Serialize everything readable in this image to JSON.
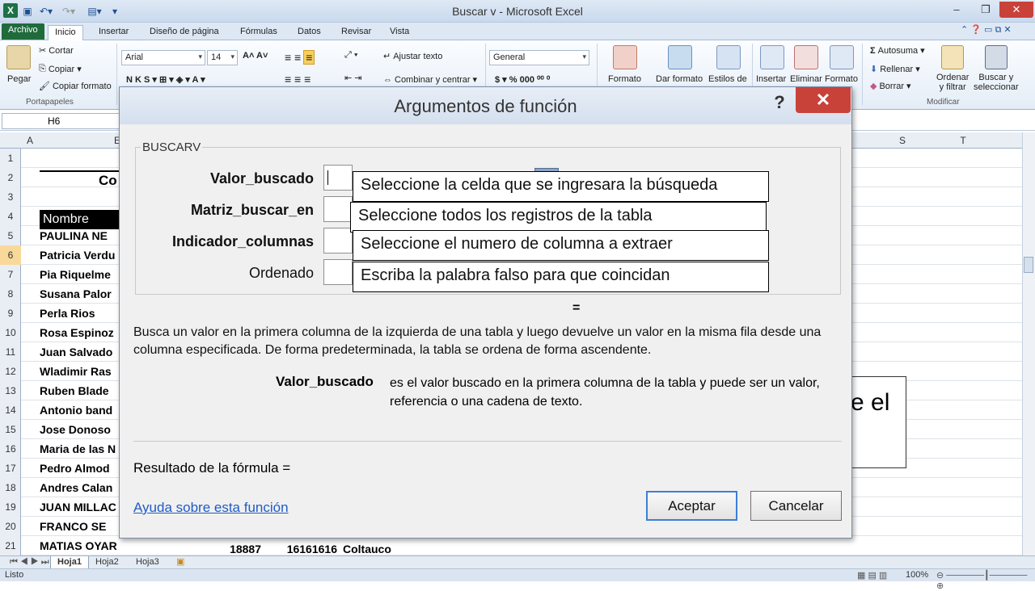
{
  "window": {
    "title": "Buscar v  -  Microsoft Excel"
  },
  "ribbon_tabs": [
    "Archivo",
    "Inicio",
    "Insertar",
    "Diseño de página",
    "Fórmulas",
    "Datos",
    "Revisar",
    "Vista"
  ],
  "ribbon": {
    "paste": "Pegar",
    "cut": "Cortar",
    "copy": "Copiar",
    "copy_format": "Copiar formato",
    "clipboard_group": "Portapapeles",
    "font_name": "Arial",
    "font_size": "14",
    "wrap_text": "Ajustar texto",
    "merge_center": "Combinar y centrar",
    "number_format": "General",
    "format_btn": "Formato",
    "give_format": "Dar formato",
    "styles": "Estilos de",
    "insert": "Insertar",
    "delete": "Eliminar",
    "format2": "Formato",
    "autosum": "Autosuma",
    "fill": "Rellenar",
    "clear": "Borrar",
    "sort_filter_1": "Ordenar",
    "sort_filter_2": "y filtrar",
    "find_select_1": "Buscar y",
    "find_select_2": "seleccionar",
    "modify_group": "Modificar"
  },
  "namebox": "H6",
  "columns": {
    "a": "A",
    "b": "E",
    "s": "S",
    "t": "T"
  },
  "sheet": {
    "title_fragment": "Co",
    "header": "Nombre",
    "rows": [
      {
        "n": "1",
        "name": ""
      },
      {
        "n": "2",
        "name": ""
      },
      {
        "n": "3",
        "name": ""
      },
      {
        "n": "4",
        "name": ""
      },
      {
        "n": "5",
        "name": "PAULINA  NE"
      },
      {
        "n": "6",
        "name": "Patricia Verdu"
      },
      {
        "n": "7",
        "name": "Pia Riquelme"
      },
      {
        "n": "8",
        "name": "Susana Palor"
      },
      {
        "n": "9",
        "name": "Perla Rios"
      },
      {
        "n": "10",
        "name": "Rosa Espinoz"
      },
      {
        "n": "11",
        "name": "Juan Salvado"
      },
      {
        "n": "12",
        "name": "Wladimir Ras"
      },
      {
        "n": "13",
        "name": "Ruben Blade"
      },
      {
        "n": "14",
        "name": "Antonio band"
      },
      {
        "n": "15",
        "name": "Jose Donoso"
      },
      {
        "n": "16",
        "name": "Maria de las N"
      },
      {
        "n": "17",
        "name": "Pedro Almod"
      },
      {
        "n": "18",
        "name": "Andres Calan"
      },
      {
        "n": "19",
        "name": "JUAN MILLAC"
      },
      {
        "n": "20",
        "name": "FRANCO  SE"
      },
      {
        "n": "21",
        "name": "MATIAS  OYARZUN"
      }
    ],
    "row21_c": "18887",
    "row21_d": "16161616",
    "row21_e": "Coltauco"
  },
  "sheet_tabs": [
    "Hoja1",
    "Hoja2",
    "Hoja3"
  ],
  "status": {
    "left": "Listo",
    "zoom": "100%"
  },
  "background_text": "e el",
  "dialog": {
    "title": "Argumentos de función",
    "help": "?",
    "close": "✕",
    "function_name": "BUSCARV",
    "args": [
      {
        "label": "Valor_buscado",
        "callout": "Seleccione la celda que se ingresara la búsqueda"
      },
      {
        "label": "Matriz_buscar_en",
        "callout": "Seleccione  todos los registros de la tabla"
      },
      {
        "label": "Indicador_columnas",
        "callout": "Seleccione  el numero de columna a extraer"
      },
      {
        "label": "Ordenado",
        "callout": "Escriba la palabra falso para que coincidan"
      }
    ],
    "equals": "=",
    "description": "Busca un valor en la primera columna de la izquierda de una tabla y luego devuelve un valor en la misma fila desde una columna especificada. De forma predeterminada, la tabla se ordena de forma ascendente.",
    "current_arg": "Valor_buscado",
    "current_arg_desc": "es el valor buscado en la primera columna de la tabla y puede ser un valor, referencia o una cadena de texto.",
    "result_label": "Resultado de la fórmula =",
    "help_link": "Ayuda sobre esta función",
    "ok": "Aceptar",
    "cancel": "Cancelar"
  }
}
